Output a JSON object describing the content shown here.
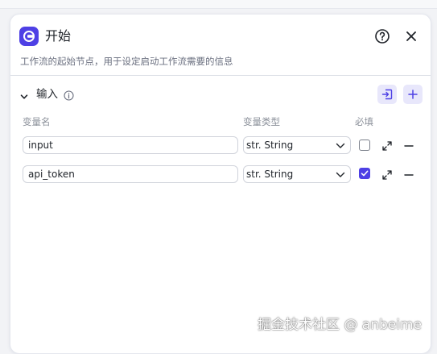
{
  "node": {
    "title": "开始",
    "description": "工作流的起始节点，用于设定启动工作流需要的信息",
    "header_icon": "start-node-icon",
    "actions": {
      "help_icon": "help-circle-icon",
      "close_icon": "close-icon"
    }
  },
  "inputs_section": {
    "title": "输入",
    "info_icon": "info-icon",
    "collapse_icon": "chevron-down-icon",
    "import_icon": "import-icon",
    "add_icon": "plus-icon",
    "columns": {
      "name": "变量名",
      "type": "变量类型",
      "required": "必填"
    },
    "rows": [
      {
        "name": "input",
        "type": "str. String",
        "required": false
      },
      {
        "name": "api_token",
        "type": "str. String",
        "required": true
      }
    ]
  },
  "watermark": "掘金技术社区 @ anbeime",
  "colors": {
    "accent": "#4e40e5",
    "accent_light": "#e8e7fb",
    "border": "#d0d3db",
    "muted_text": "#8a8f99"
  }
}
